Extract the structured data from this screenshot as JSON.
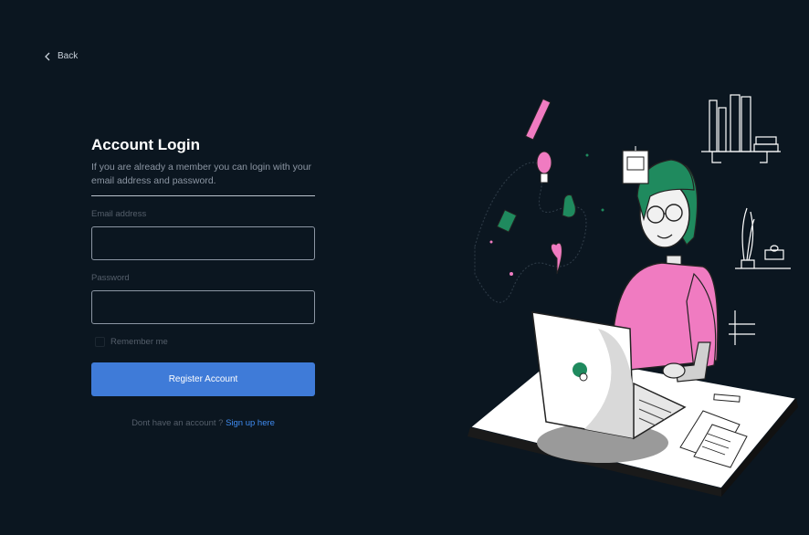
{
  "nav": {
    "back_label": "Back"
  },
  "login": {
    "title": "Account Login",
    "subtitle": "If you are already a member you can login with your email address and password.",
    "email_label": "Email address",
    "email_value": "",
    "password_label": "Password",
    "password_value": "",
    "remember_label": "Remember me",
    "submit_label": "Register Account",
    "signup_prompt": "Dont have an account ? ",
    "signup_link": "Sign up here"
  },
  "colors": {
    "background": "#0b1620",
    "button": "#3f7bd8",
    "link": "#3f8bf0",
    "illustration_pink": "#f07bc1",
    "illustration_green": "#1f8a5e"
  }
}
